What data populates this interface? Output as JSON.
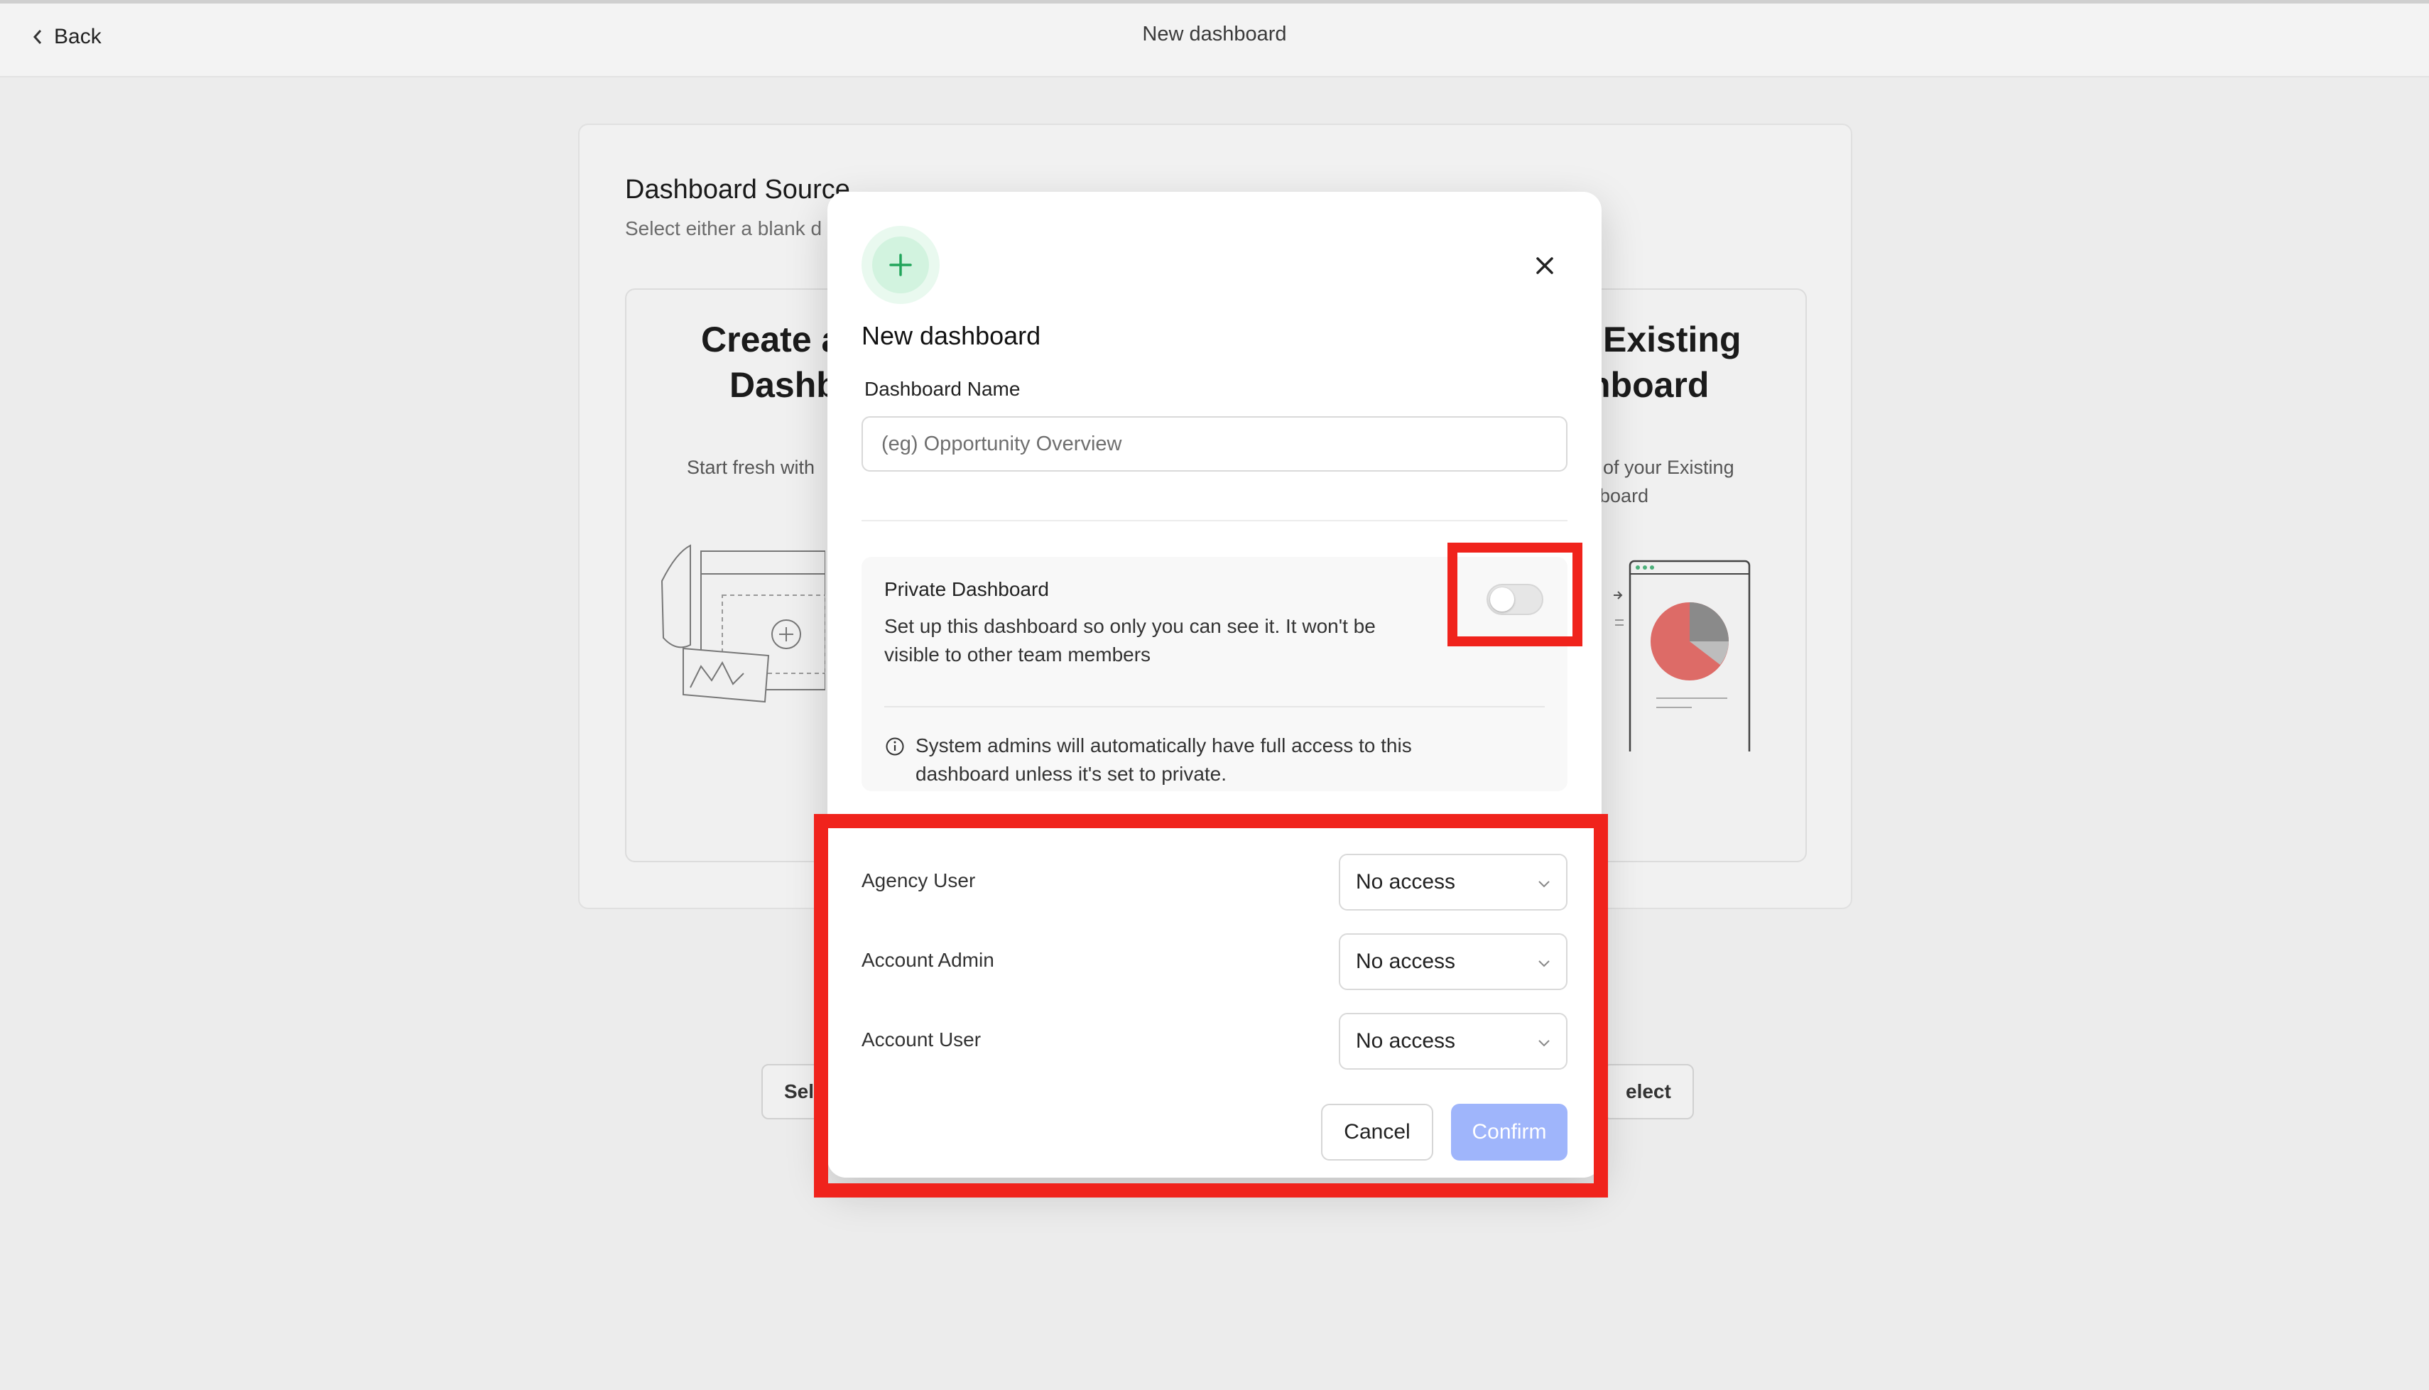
{
  "topbar": {
    "back_label": "Back",
    "title": "New dashboard"
  },
  "background": {
    "source_title": "Dashboard Source",
    "source_subtitle": "Select either a blank d",
    "left_card": {
      "title_line1": "Create a",
      "title_line2": "Dashb",
      "desc": "Start fresh with",
      "button": "Selec"
    },
    "right_card": {
      "title_line1": "Existing",
      "title_line2": "hboard",
      "desc_line1": "of your Existing",
      "desc_line2": "hboard",
      "button": "elect"
    }
  },
  "modal": {
    "title": "New dashboard",
    "name_label": "Dashboard Name",
    "name_placeholder": "(eg) Opportunity Overview",
    "name_value": "",
    "private": {
      "title": "Private Dashboard",
      "description": "Set up this dashboard so only you can see it. It won't be visible to other team members",
      "enabled": false
    },
    "info_text": "System admins will automatically have full access to this dashboard unless it's set to private.",
    "roles": [
      {
        "label": "Agency User",
        "access": "No access"
      },
      {
        "label": "Account Admin",
        "access": "No access"
      },
      {
        "label": "Account User",
        "access": "No access"
      }
    ],
    "cancel_label": "Cancel",
    "confirm_label": "Confirm"
  },
  "colors": {
    "accent_green": "#22a55b",
    "confirm_disabled": "#9fb5fb",
    "highlight_red": "#f0231c",
    "pie_red": "#d9534f",
    "pie_gray": "#8a8a8a"
  },
  "icons": {
    "back": "chevron-left-icon",
    "add": "plus-icon",
    "close": "close-icon",
    "info": "info-icon",
    "dropdown": "chevron-down-icon"
  }
}
